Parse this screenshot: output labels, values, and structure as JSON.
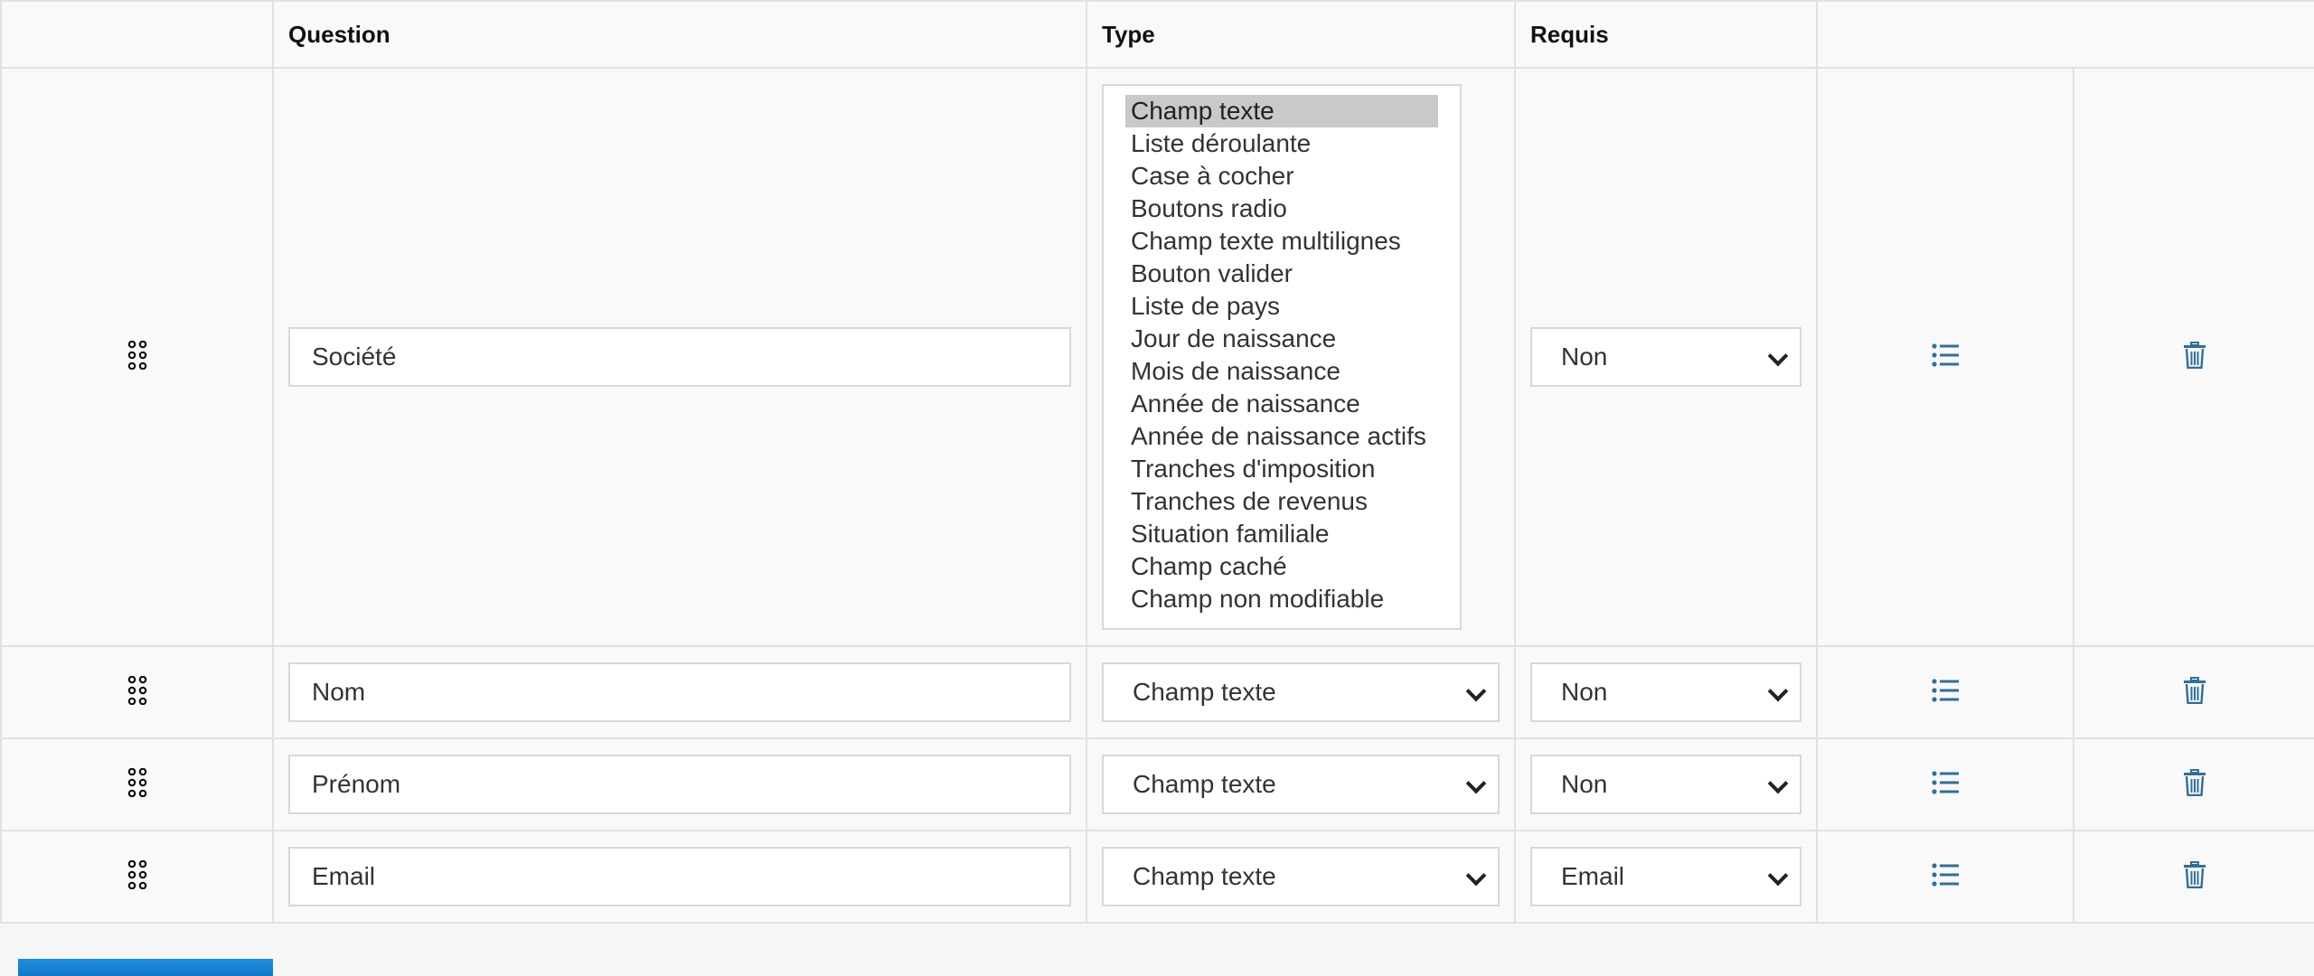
{
  "headers": {
    "handle": "",
    "question": "Question",
    "type": "Type",
    "required": "Requis",
    "actions": ""
  },
  "type_options": [
    "Champ texte",
    "Liste déroulante",
    "Case à cocher",
    "Boutons radio",
    "Champ texte multilignes",
    "Bouton valider",
    "Liste de pays",
    "Jour de naissance",
    "Mois de naissance",
    "Année de naissance",
    "Année de naissance actifs",
    "Tranches d'imposition",
    "Tranches de revenus",
    "Situation familiale",
    "Champ caché",
    "Champ non modifiable"
  ],
  "rows": [
    {
      "question": "Société",
      "type": "Champ texte",
      "required": "Non"
    },
    {
      "question": "Nom",
      "type": "Champ texte",
      "required": "Non"
    },
    {
      "question": "Prénom",
      "type": "Champ texte",
      "required": "Non"
    },
    {
      "question": "Email",
      "type": "Champ texte",
      "required": "Email"
    }
  ],
  "icons": {
    "drag": "drag-handle-icon",
    "options": "list-icon",
    "delete": "trash-icon"
  },
  "colors": {
    "icon_accent": "#2f6f9a",
    "button_blue": "#1a84d6"
  }
}
